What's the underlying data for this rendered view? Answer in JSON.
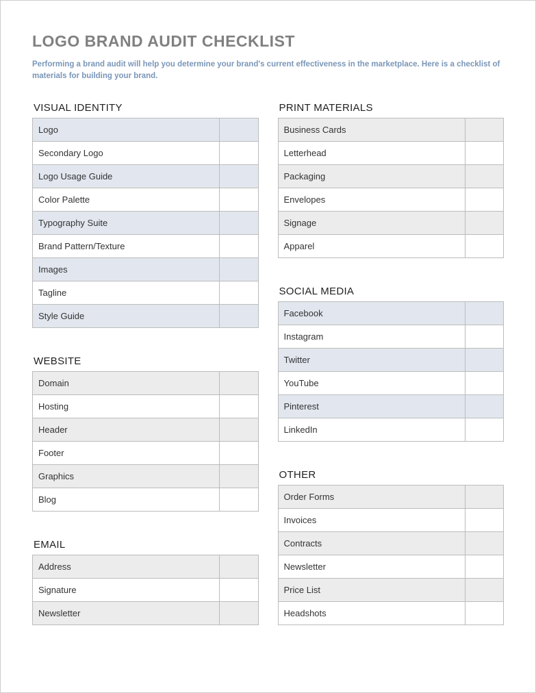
{
  "title": "LOGO BRAND AUDIT CHECKLIST",
  "subtitle": "Performing a brand audit will help you determine your brand's current effectiveness in the marketplace. Here is a checklist of materials for building your brand.",
  "sections": {
    "visual_identity": {
      "heading": "VISUAL IDENTITY",
      "items": [
        "Logo",
        "Secondary Logo",
        "Logo Usage Guide",
        "Color Palette",
        "Typography Suite",
        "Brand Pattern/Texture",
        "Images",
        "Tagline",
        "Style Guide"
      ],
      "style": "blue"
    },
    "website": {
      "heading": "WEBSITE",
      "items": [
        "Domain",
        "Hosting",
        "Header",
        "Footer",
        "Graphics",
        "Blog"
      ],
      "style": "grey"
    },
    "email": {
      "heading": "EMAIL",
      "items": [
        "Address",
        "Signature",
        "Newsletter"
      ],
      "style": "grey"
    },
    "print_materials": {
      "heading": "PRINT MATERIALS",
      "items": [
        "Business Cards",
        "Letterhead",
        "Packaging",
        "Envelopes",
        "Signage",
        "Apparel"
      ],
      "style": "grey"
    },
    "social_media": {
      "heading": "SOCIAL MEDIA",
      "items": [
        "Facebook",
        "Instagram",
        "Twitter",
        "YouTube",
        "Pinterest",
        "LinkedIn"
      ],
      "style": "blue"
    },
    "other": {
      "heading": "OTHER",
      "items": [
        "Order Forms",
        "Invoices",
        "Contracts",
        "Newsletter",
        "Price List",
        "Headshots"
      ],
      "style": "grey"
    }
  }
}
